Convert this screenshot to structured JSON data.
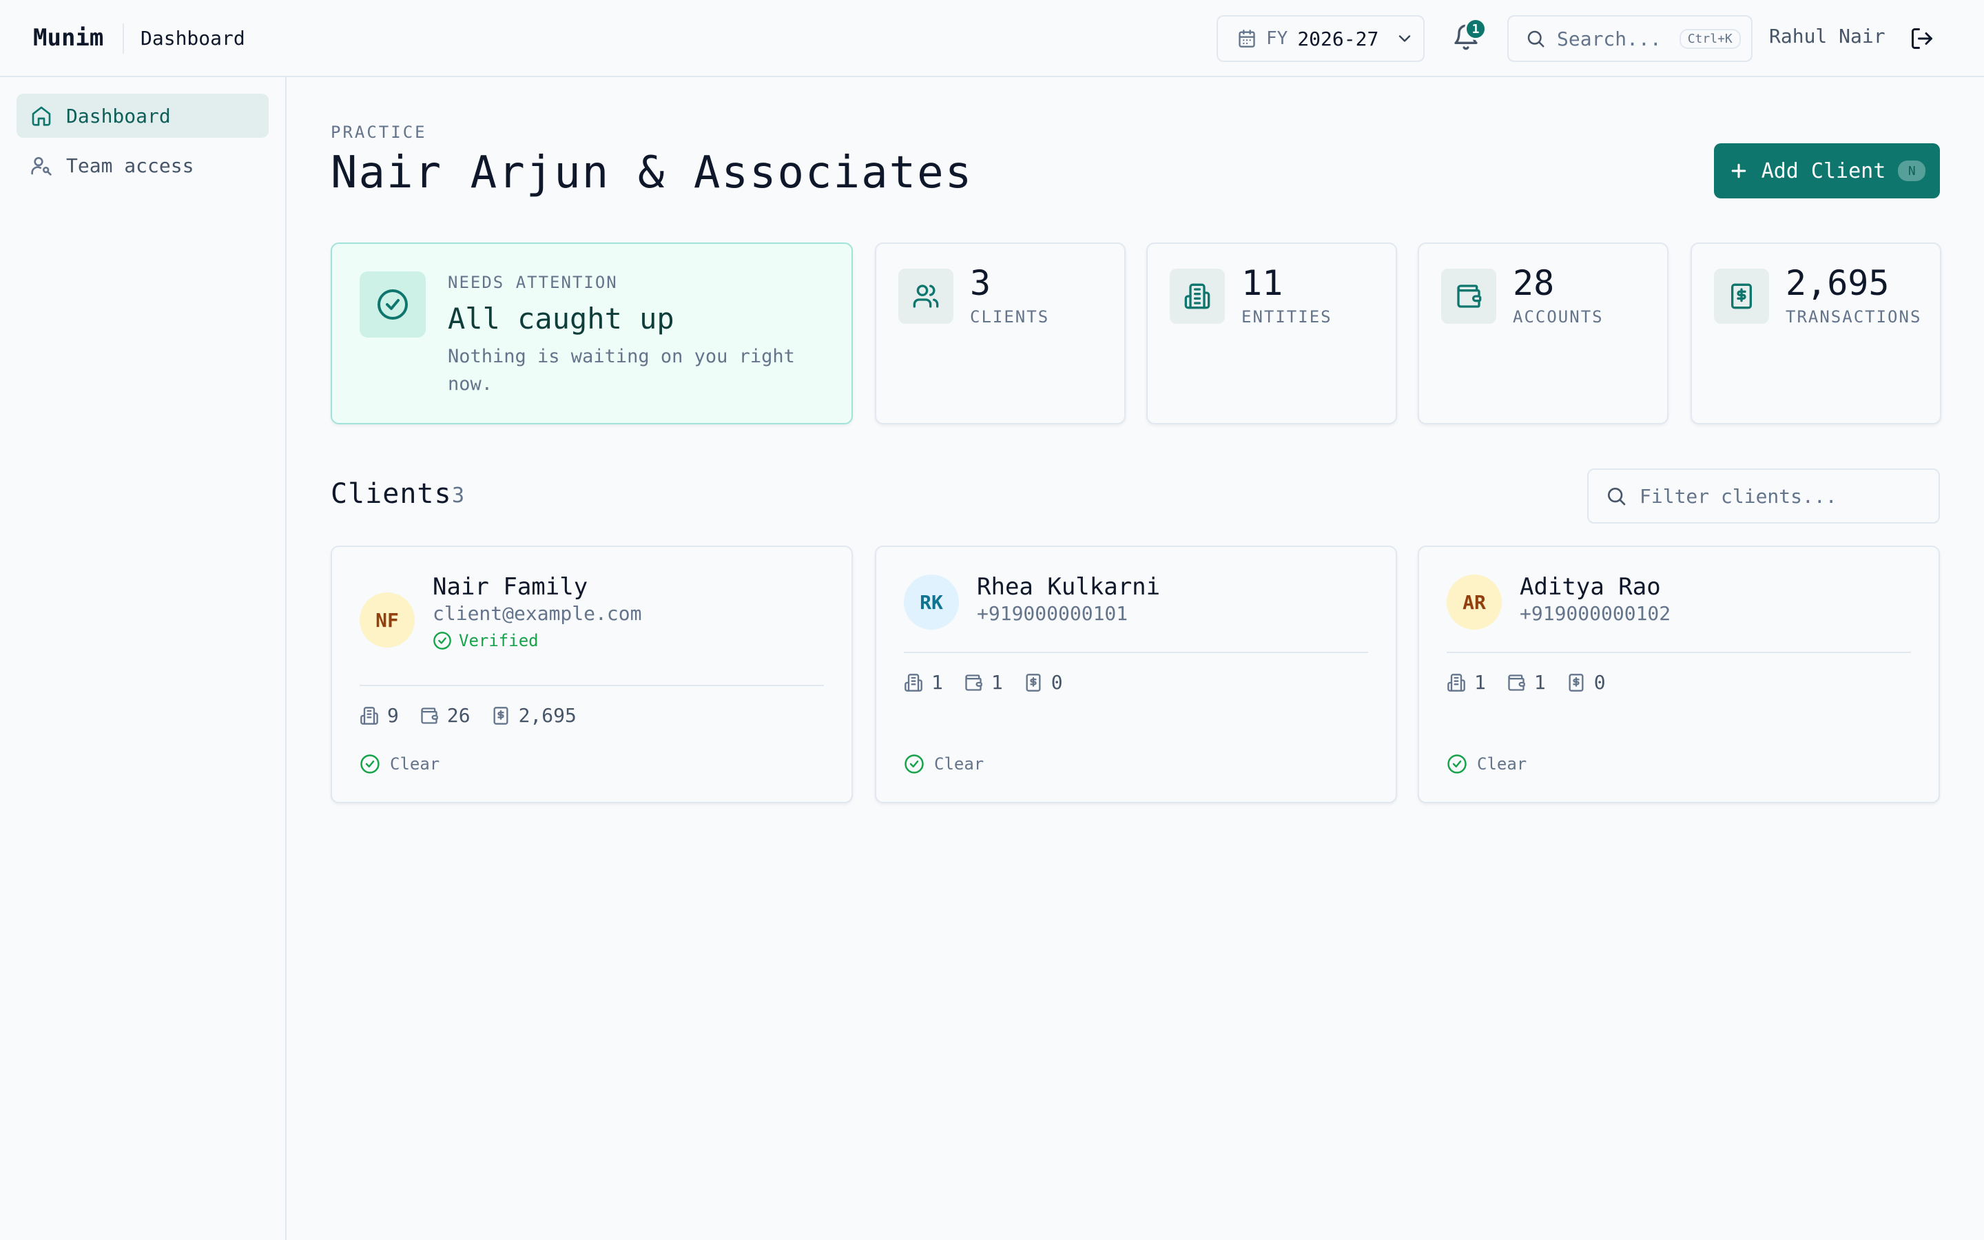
{
  "header": {
    "brand": "Munim",
    "breadcrumb": "Dashboard",
    "fy_label": "FY",
    "fy_value": "2026-27",
    "notification_count": "1",
    "search_placeholder": "Search...",
    "search_shortcut": "Ctrl+K",
    "user_name": "Rahul Nair"
  },
  "sidebar": {
    "items": [
      {
        "label": "Dashboard",
        "icon": "home-icon",
        "active": true
      },
      {
        "label": "Team access",
        "icon": "user-key-icon",
        "active": false
      }
    ]
  },
  "main": {
    "eyebrow": "PRACTICE",
    "title": "Nair Arjun & Associates",
    "add_button": {
      "label": "Add Client",
      "shortcut": "N"
    },
    "attention": {
      "eyebrow": "NEEDS ATTENTION",
      "title": "All caught up",
      "description": "Nothing is waiting on you right now."
    },
    "stats": [
      {
        "value": "3",
        "label": "CLIENTS",
        "icon": "users-icon"
      },
      {
        "value": "11",
        "label": "ENTITIES",
        "icon": "building-icon"
      },
      {
        "value": "28",
        "label": "ACCOUNTS",
        "icon": "wallet-icon"
      },
      {
        "value": "2,695",
        "label": "TRANSACTIONS",
        "icon": "receipt-icon"
      }
    ],
    "clients_section": {
      "title": "Clients",
      "count": "3",
      "filter_placeholder": "Filter clients..."
    },
    "clients": [
      {
        "initials": "NF",
        "name": "Nair Family",
        "contact": "client@example.com",
        "verified": "Verified",
        "entities": "9",
        "accounts": "26",
        "transactions": "2,695",
        "status": "Clear",
        "avatar_bg": "#fef3c7",
        "avatar_fg": "#92400e"
      },
      {
        "initials": "RK",
        "name": "Rhea Kulkarni",
        "contact": "+919000000101",
        "entities": "1",
        "accounts": "1",
        "transactions": "0",
        "status": "Clear",
        "avatar_bg": "#e0f2fe",
        "avatar_fg": "#0e7490"
      },
      {
        "initials": "AR",
        "name": "Aditya Rao",
        "contact": "+919000000102",
        "entities": "1",
        "accounts": "1",
        "transactions": "0",
        "status": "Clear",
        "avatar_bg": "#fef3c7",
        "avatar_fg": "#92400e"
      }
    ]
  },
  "colors": {
    "accent": "#0f766e",
    "success": "#16a34a",
    "muted": "#64748b",
    "border": "#e2e8f0"
  }
}
